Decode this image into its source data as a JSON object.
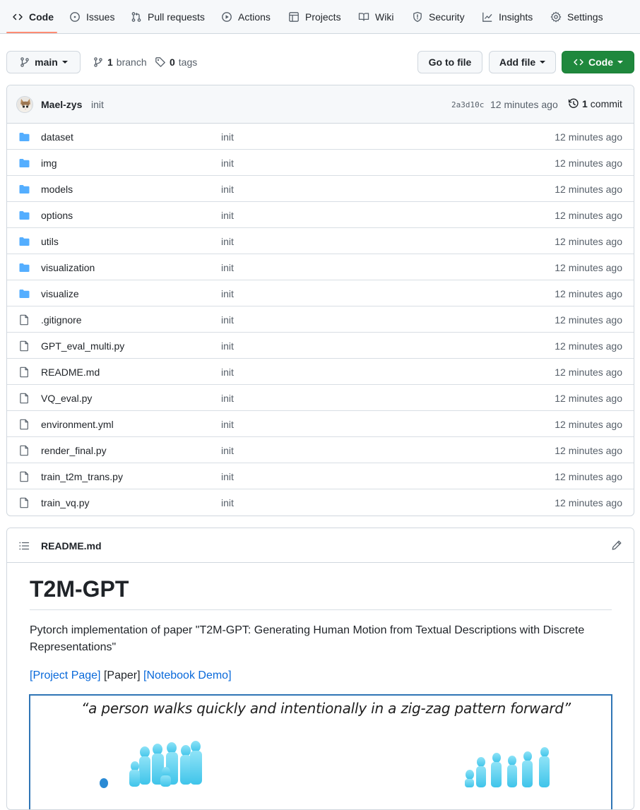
{
  "repo_nav": {
    "tabs": [
      {
        "label": "Code",
        "icon": "code-icon",
        "selected": true
      },
      {
        "label": "Issues",
        "icon": "issue-icon"
      },
      {
        "label": "Pull requests",
        "icon": "pull-request-icon"
      },
      {
        "label": "Actions",
        "icon": "play-icon"
      },
      {
        "label": "Projects",
        "icon": "table-icon"
      },
      {
        "label": "Wiki",
        "icon": "book-icon"
      },
      {
        "label": "Security",
        "icon": "shield-icon"
      },
      {
        "label": "Insights",
        "icon": "graph-icon"
      },
      {
        "label": "Settings",
        "icon": "gear-icon"
      }
    ]
  },
  "branch_bar": {
    "branch": "main",
    "branch_count": "1",
    "branch_label": "branch",
    "tag_count": "0",
    "tag_label": "tags",
    "go_to_file": "Go to file",
    "add_file": "Add file",
    "code": "Code"
  },
  "latest_commit": {
    "author": "Mael-zys",
    "message": "init",
    "sha": "2a3d10c",
    "time": "12 minutes ago",
    "commit_count": "1",
    "commit_label": "commit"
  },
  "files": [
    {
      "name": "dataset",
      "type": "dir",
      "message": "init",
      "time": "12 minutes ago"
    },
    {
      "name": "img",
      "type": "dir",
      "message": "init",
      "time": "12 minutes ago"
    },
    {
      "name": "models",
      "type": "dir",
      "message": "init",
      "time": "12 minutes ago"
    },
    {
      "name": "options",
      "type": "dir",
      "message": "init",
      "time": "12 minutes ago"
    },
    {
      "name": "utils",
      "type": "dir",
      "message": "init",
      "time": "12 minutes ago"
    },
    {
      "name": "visualization",
      "type": "dir",
      "message": "init",
      "time": "12 minutes ago"
    },
    {
      "name": "visualize",
      "type": "dir",
      "message": "init",
      "time": "12 minutes ago"
    },
    {
      "name": ".gitignore",
      "type": "file",
      "message": "init",
      "time": "12 minutes ago"
    },
    {
      "name": "GPT_eval_multi.py",
      "type": "file",
      "message": "init",
      "time": "12 minutes ago"
    },
    {
      "name": "README.md",
      "type": "file",
      "message": "init",
      "time": "12 minutes ago"
    },
    {
      "name": "VQ_eval.py",
      "type": "file",
      "message": "init",
      "time": "12 minutes ago"
    },
    {
      "name": "environment.yml",
      "type": "file",
      "message": "init",
      "time": "12 minutes ago"
    },
    {
      "name": "render_final.py",
      "type": "file",
      "message": "init",
      "time": "12 minutes ago"
    },
    {
      "name": "train_t2m_trans.py",
      "type": "file",
      "message": "init",
      "time": "12 minutes ago"
    },
    {
      "name": "train_vq.py",
      "type": "file",
      "message": "init",
      "time": "12 minutes ago"
    }
  ],
  "readme": {
    "filename": "README.md",
    "title": "T2M-GPT",
    "description": "Pytorch implementation of paper \"T2M-GPT: Generating Human Motion from Textual Descriptions with Discrete Representations\"",
    "links": [
      {
        "text": "[Project Page]",
        "is_link": true
      },
      {
        "text": "[Paper]",
        "is_link": false
      },
      {
        "text": "[Notebook Demo]",
        "is_link": true
      }
    ],
    "teaser_caption": "“a person walks quickly and intentionally in a zig-zag pattern forward”"
  },
  "colors": {
    "accent_underline": "#fd8c73",
    "folder": "#54aeff",
    "green_button": "#1f883d",
    "link": "#0969da",
    "figure": "#5fd3f0",
    "teaser_border": "#2f75b5"
  }
}
